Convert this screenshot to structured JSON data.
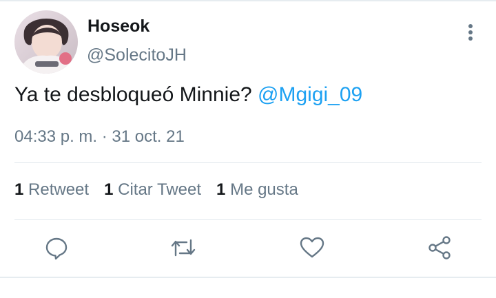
{
  "tweet": {
    "author": {
      "display_name": "Hoseok",
      "handle": "@SolecitoJH",
      "avatar_icon": "profile-photo"
    },
    "text": "Ya te desbloqueó Minnie? ",
    "mention": "@Mgigi_09",
    "timestamp": "04:33 p. m. · 31 oct. 21",
    "stats": {
      "retweets_count": "1",
      "retweets_label": " Retweet",
      "quotes_count": "1",
      "quotes_label": " Citar Tweet",
      "likes_count": "1",
      "likes_label": " Me gusta"
    },
    "actions": {
      "reply_icon": "comment-icon",
      "retweet_icon": "retweet-icon",
      "like_icon": "heart-icon",
      "share_icon": "share-icon"
    },
    "more_icon": "more-vertical-icon"
  },
  "colors": {
    "accent": "#1da1f2",
    "secondary_text": "#657786",
    "primary_text": "#14171a",
    "divider": "#e1e8ed"
  }
}
